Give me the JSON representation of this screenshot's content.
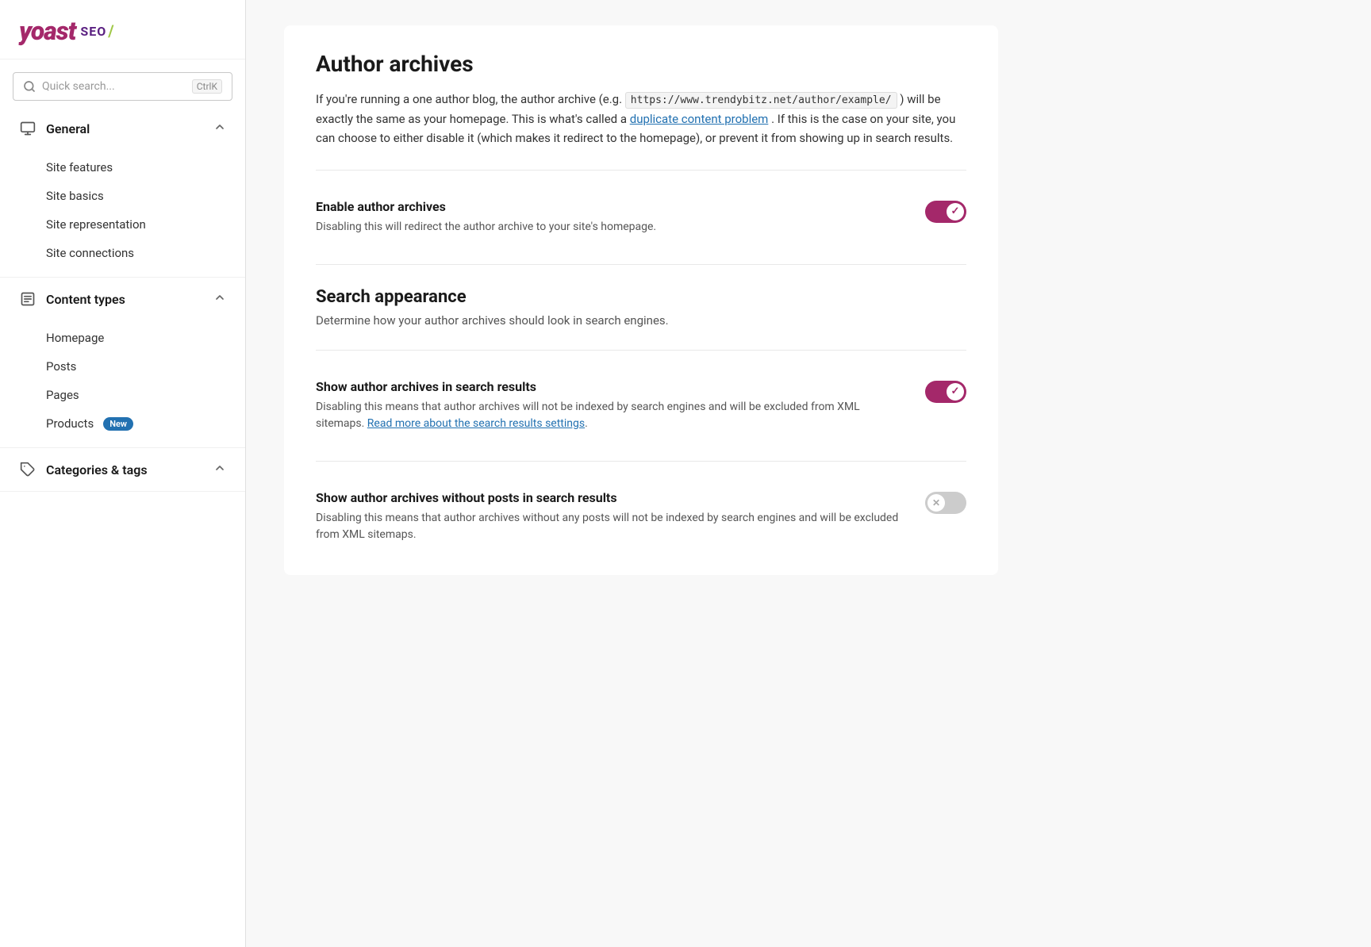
{
  "logo": {
    "yoast": "yoast",
    "seo": "SEO",
    "slash": "/"
  },
  "search": {
    "placeholder": "Quick search...",
    "shortcut": "CtrlK"
  },
  "sidebar": {
    "sections": [
      {
        "id": "general",
        "icon": "monitor-icon",
        "title": "General",
        "expanded": true,
        "items": [
          {
            "id": "site-features",
            "label": "Site features",
            "active": false,
            "badge": null
          },
          {
            "id": "site-basics",
            "label": "Site basics",
            "active": false,
            "badge": null
          },
          {
            "id": "site-representation",
            "label": "Site representation",
            "active": false,
            "badge": null
          },
          {
            "id": "site-connections",
            "label": "Site connections",
            "active": false,
            "badge": null
          }
        ]
      },
      {
        "id": "content-types",
        "icon": "document-icon",
        "title": "Content types",
        "expanded": true,
        "items": [
          {
            "id": "homepage",
            "label": "Homepage",
            "active": false,
            "badge": null
          },
          {
            "id": "posts",
            "label": "Posts",
            "active": false,
            "badge": null
          },
          {
            "id": "pages",
            "label": "Pages",
            "active": false,
            "badge": null
          },
          {
            "id": "products",
            "label": "Products",
            "active": false,
            "badge": "New"
          }
        ]
      },
      {
        "id": "categories-tags",
        "icon": "tag-icon",
        "title": "Categories & tags",
        "expanded": true,
        "items": []
      }
    ]
  },
  "main": {
    "title": "Author archives",
    "intro_line1": "If you're running a one author blog, the author archive (e.g.",
    "intro_code": "https://www.trendybitz.net/author/example/",
    "intro_line2": ") will be exactly the same as your homepage. This is what's called a",
    "intro_link": "duplicate content problem",
    "intro_line3": ". If this is the case on your site, you can choose to either disable it (which makes it redirect to the homepage), or prevent it from showing up in search results.",
    "settings": [
      {
        "id": "enable-author-archives",
        "label": "Enable author archives",
        "description": "Disabling this will redirect the author archive to your site's homepage.",
        "toggle": "on"
      }
    ],
    "search_appearance": {
      "title": "Search appearance",
      "description": "Determine how your author archives should look in search engines.",
      "settings": [
        {
          "id": "show-in-search-results",
          "label": "Show author archives in search results",
          "description": "Disabling this means that author archives will not be indexed by search engines and will be excluded from XML sitemaps.",
          "link_text": "Read more about the search results settings",
          "toggle": "on"
        },
        {
          "id": "show-without-posts",
          "label": "Show author archives without posts in search results",
          "description": "Disabling this means that author archives without any posts will not be indexed by search engines and will be excluded from XML sitemaps.",
          "toggle": "off"
        }
      ]
    }
  }
}
